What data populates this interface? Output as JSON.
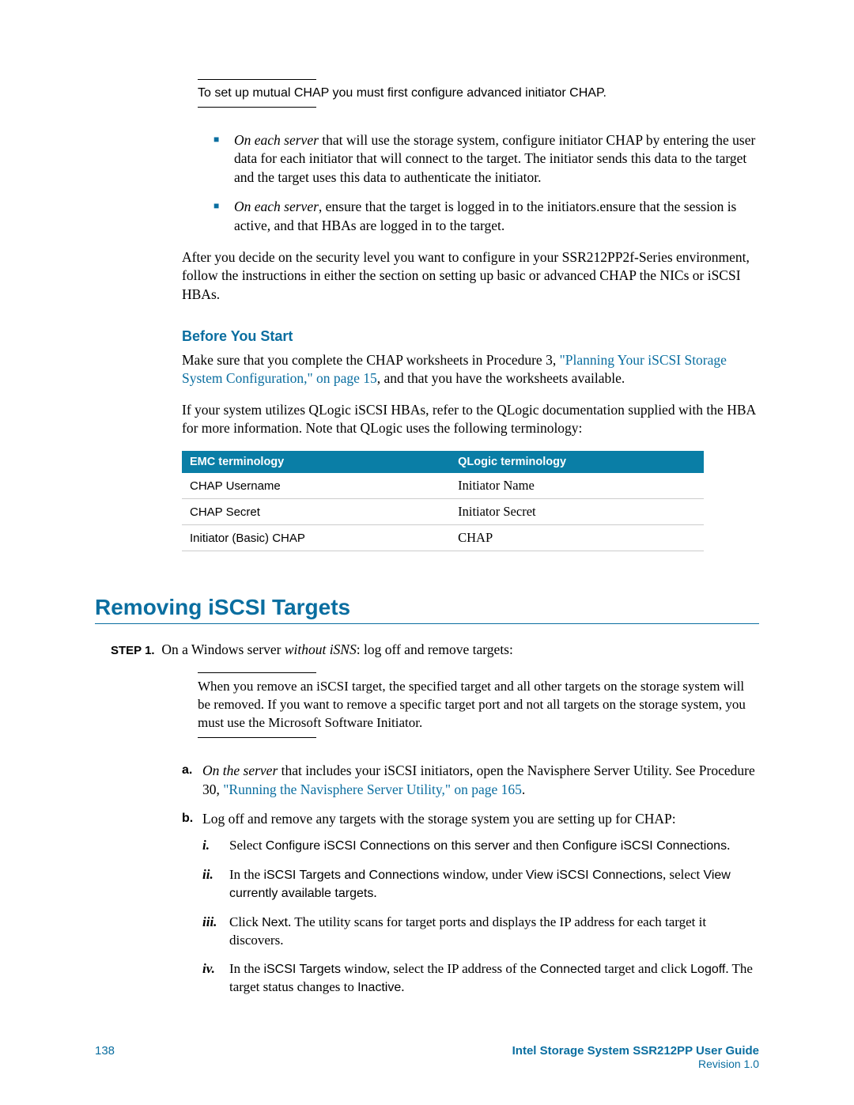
{
  "note1": "To set up mutual CHAP you must first configure advanced initiator CHAP.",
  "bullets": [
    {
      "lead": "On each server",
      "rest": " that will use the storage system, configure initiator CHAP by entering the user data for each initiator that will connect to the target. The initiator sends this data to the target and the target uses this data to authenticate the initiator."
    },
    {
      "lead": "On each server",
      "rest": ", ensure that the target is logged in to the initiators.ensure that the session is active, and that HBAs are logged in to the target."
    }
  ],
  "after_para": "After you decide on the security level you want to configure in your SSR212PP2f-Series environment, follow the instructions in either the section on setting up basic or advanced CHAP the NICs or iSCSI HBAs.",
  "before_heading": "Before You Start",
  "before_p1_pre": "Make sure that you complete the CHAP worksheets in Procedure 3, ",
  "before_p1_link": "\"Planning Your iSCSI Storage System Configuration,\" on page 15",
  "before_p1_post": ", and that you have the worksheets available.",
  "before_p2": "If your system utilizes QLogic iSCSI HBAs, refer to the QLogic documentation supplied with the HBA for more information. Note that QLogic uses the following terminology:",
  "table": {
    "headers": [
      "EMC terminology",
      "QLogic terminology"
    ],
    "rows": [
      [
        "CHAP Username",
        "Initiator Name"
      ],
      [
        "CHAP Secret",
        "Initiator Secret"
      ],
      [
        "Initiator (Basic) CHAP",
        "CHAP"
      ]
    ]
  },
  "h1": "Removing iSCSI Targets",
  "step_label": "STEP 1.",
  "step_pre": "On a Windows server ",
  "step_ital": "without iSNS",
  "step_post": ": log off and remove targets:",
  "note2": "When you remove an iSCSI target, the specified target and all other targets on the storage system will be removed. If you want to remove a specific target port and not all targets on the storage system, you must use the Microsoft Software Initiator.",
  "letters": {
    "a_lead": "On the server",
    "a_rest": " that includes your iSCSI initiators, open the Navisphere Server Utility. See Procedure 30, ",
    "a_link": "\"Running the Navisphere Server Utility,\" on page 165",
    "a_post": ".",
    "b": "Log off and remove any targets with the storage system you are setting up for CHAP:"
  },
  "romans": {
    "i_pre": "Select ",
    "i_ui1": "Configure iSCSI Connections on this server",
    "i_mid": " and then ",
    "i_ui2": "Configure iSCSI Connections",
    "i_post": ".",
    "ii_pre": "In the ",
    "ii_ui1": "iSCSI Targets and Connections",
    "ii_mid": " window, under ",
    "ii_ui2": "View iSCSI Connections",
    "ii_mid2": ", select ",
    "ii_ui3": "View currently available targets",
    "ii_post": ".",
    "iii_pre": "Click ",
    "iii_ui1": "Next",
    "iii_post": ". The utility scans for target ports and displays the IP address for each target it discovers.",
    "iv_pre": "In the ",
    "iv_ui1": "iSCSI Targets",
    "iv_mid": " window, select the IP address of the ",
    "iv_ui2": "Connected",
    "iv_mid2": " target and click ",
    "iv_ui3": "Logoff",
    "iv_mid3": ". The target status changes to ",
    "iv_ui4": "Inactive",
    "iv_post": "."
  },
  "footer": {
    "page": "138",
    "guide": "Intel Storage System SSR212PP User Guide",
    "rev": "Revision 1.0"
  }
}
